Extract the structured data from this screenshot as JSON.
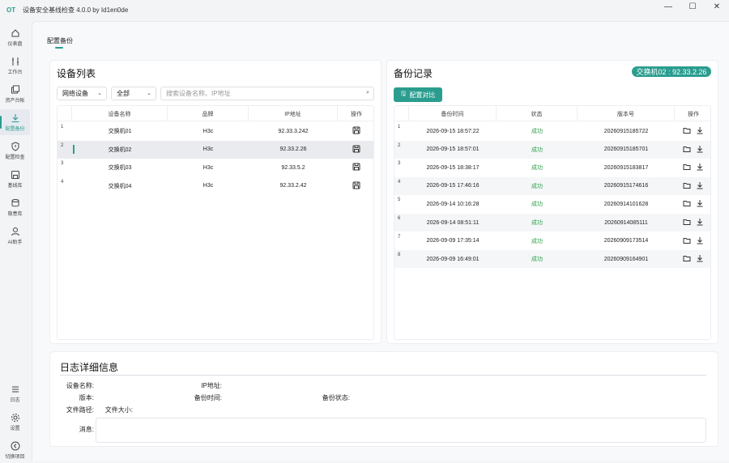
{
  "app": {
    "logo": "OT",
    "title": "设备安全基线检查 4.0.0 by Id1en0de"
  },
  "window": {
    "minimize": "—",
    "maximize": "☐",
    "close": "✕"
  },
  "sidebar": {
    "items": [
      {
        "label": "仪表盘",
        "icon": "dashboard-icon"
      },
      {
        "label": "工作台",
        "icon": "tools-icon"
      },
      {
        "label": "资产台帐",
        "icon": "assets-icon"
      },
      {
        "label": "配置备份",
        "icon": "download-icon",
        "active": true
      },
      {
        "label": "配置检查",
        "icon": "shield-icon"
      },
      {
        "label": "基线库",
        "icon": "save-icon"
      },
      {
        "label": "隐患库",
        "icon": "database-icon"
      },
      {
        "label": "AI助手",
        "icon": "user-icon"
      }
    ],
    "bottom": [
      {
        "label": "日志",
        "icon": "menu-icon"
      },
      {
        "label": "设置",
        "icon": "gear-icon"
      },
      {
        "label": "切换项目",
        "icon": "back-icon"
      }
    ]
  },
  "page": {
    "tab": "配置备份"
  },
  "devices": {
    "title": "设备列表",
    "filter_type": "网络设备",
    "filter_all": "全部",
    "search_placeholder": "搜索设备名称、IP地址",
    "columns": [
      "设备名称",
      "品牌",
      "IP地址",
      "操作"
    ],
    "rows": [
      {
        "num": "1",
        "name": "交换机01",
        "brand": "H3c",
        "ip": "92.33.3.242"
      },
      {
        "num": "2",
        "name": "交换机02",
        "brand": "H3c",
        "ip": "92.33.2.26"
      },
      {
        "num": "3",
        "name": "交换机03",
        "brand": "H3c",
        "ip": "92.33.5.2"
      },
      {
        "num": "4",
        "name": "交换机04",
        "brand": "H3c",
        "ip": "92.33.2.42"
      }
    ],
    "selected_index": 1
  },
  "backups": {
    "title": "备份记录",
    "badge": "交换机02 : 92.33.2.26",
    "compare_button": "配置对比",
    "columns": [
      "备份时间",
      "状态",
      "版本号",
      "操作"
    ],
    "rows": [
      {
        "num": "1",
        "time": "2026-09-15 18:57:22",
        "status": "成功",
        "version": "20260915185722"
      },
      {
        "num": "2",
        "time": "2026-09-15 18:57:01",
        "status": "成功",
        "version": "20260915185701"
      },
      {
        "num": "3",
        "time": "2026-09-15 18:38:17",
        "status": "成功",
        "version": "20260915183817"
      },
      {
        "num": "4",
        "time": "2026-09-15 17:46:16",
        "status": "成功",
        "version": "20260915174616"
      },
      {
        "num": "5",
        "time": "2026-09-14 10:16:28",
        "status": "成功",
        "version": "20260914101628"
      },
      {
        "num": "6",
        "time": "2026-09-14 08:51:11",
        "status": "成功",
        "version": "20260914085111"
      },
      {
        "num": "7",
        "time": "2026-09-09 17:35:14",
        "status": "成功",
        "version": "20260909173514"
      },
      {
        "num": "8",
        "time": "2026-09-09 16:49:01",
        "status": "成功",
        "version": "20260909164901"
      }
    ]
  },
  "log": {
    "title": "日志详细信息",
    "device_name_label": "设备名称:",
    "ip_label": "IP地址:",
    "version_label": "版本:",
    "backup_time_label": "备份时间:",
    "backup_status_label": "备份状态:",
    "file_path_label": "文件路径:",
    "file_size_label": "文件大小:",
    "message_label": "消息:"
  },
  "colors": {
    "accent": "#2a9d8f",
    "success": "#2e9e4a"
  }
}
